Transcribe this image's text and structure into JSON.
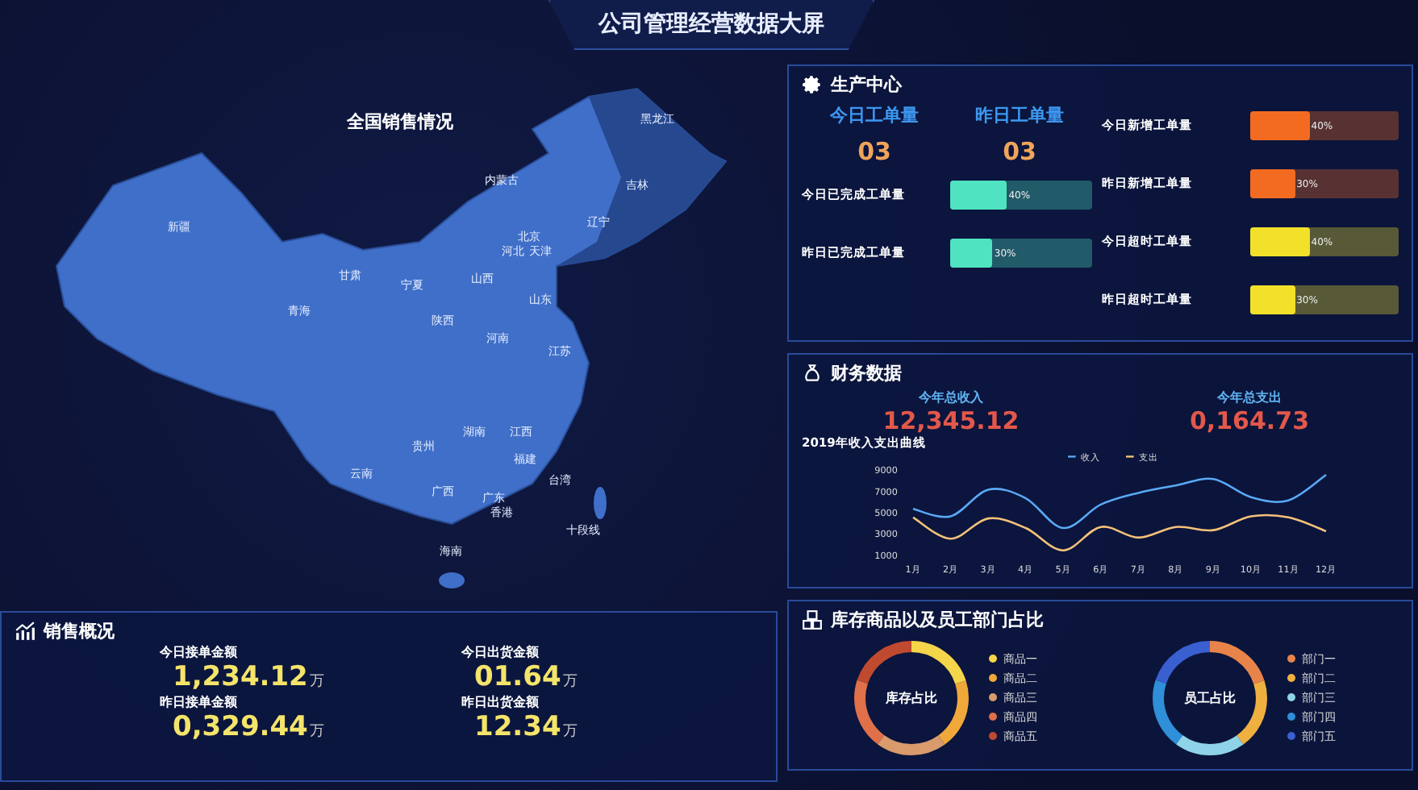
{
  "title": "公司管理经营数据大屏",
  "map": {
    "title": "全国销售情况",
    "provinces": [
      "新疆",
      "青海",
      "甘肃",
      "宁夏",
      "内蒙古",
      "黑龙江",
      "吉林",
      "辽宁",
      "北京",
      "河北",
      "天津",
      "山西",
      "山东",
      "陕西",
      "河南",
      "江苏",
      "湖南",
      "江西",
      "贵州",
      "福建",
      "云南",
      "广西",
      "广东",
      "香港",
      "台湾",
      "十段线",
      "海南"
    ]
  },
  "sales": {
    "title": "销售概况",
    "items": [
      {
        "label": "今日接单金额",
        "value": "1,234.12",
        "unit": "万"
      },
      {
        "label": "今日出货金额",
        "value": "01.64",
        "unit": "万"
      },
      {
        "label": "昨日接单金额",
        "value": "0,329.44",
        "unit": "万"
      },
      {
        "label": "昨日出货金额",
        "value": "12.34",
        "unit": "万"
      }
    ]
  },
  "production": {
    "title": "生产中心",
    "kpis": [
      {
        "label": "今日工单量",
        "value": "03"
      },
      {
        "label": "昨日工单量",
        "value": "03"
      }
    ],
    "bars": [
      {
        "label": "今日新增工单量",
        "level": 0.4,
        "reading": "40%",
        "color": "#f26b21"
      },
      {
        "label": "昨日新增工单量",
        "level": 0.3,
        "reading": "30%",
        "color": "#f26b21"
      },
      {
        "label": "今日已完成工单量",
        "level": 0.4,
        "reading": "40%",
        "color": "#4fe3c1"
      },
      {
        "label": "今日超时工单量",
        "level": 0.4,
        "reading": "40%",
        "color": "#f2e02a"
      },
      {
        "label": "昨日已完成工单量",
        "level": 0.3,
        "reading": "30%",
        "color": "#4fe3c1"
      },
      {
        "label": "昨日超时工单量",
        "level": 0.3,
        "reading": "30%",
        "color": "#f2e02a"
      }
    ]
  },
  "finance": {
    "title": "财务数据",
    "kpis": [
      {
        "label": "今年总收入",
        "value": "12,345.12"
      },
      {
        "label": "今年总支出",
        "value": "0,164.73"
      }
    ],
    "chart_data": {
      "type": "line",
      "title": "2019年收入支出曲线",
      "legend": "top",
      "categories": [
        "1月",
        "2月",
        "3月",
        "4月",
        "5月",
        "6月",
        "7月",
        "8月",
        "9月",
        "10月",
        "11月",
        "12月"
      ],
      "ylim": [
        1000,
        9000
      ],
      "yticks": [
        1000,
        3000,
        5000,
        7000,
        9000
      ],
      "series": [
        {
          "name": "收入",
          "color": "#5aa9f5",
          "values": [
            5300,
            4600,
            7100,
            6300,
            3500,
            5700,
            6800,
            7500,
            8100,
            6400,
            6100,
            8500
          ]
        },
        {
          "name": "支出",
          "color": "#f5c27a",
          "values": [
            4500,
            2500,
            4400,
            3500,
            1400,
            3600,
            2600,
            3600,
            3300,
            4600,
            4500,
            3200
          ]
        }
      ]
    }
  },
  "inventory": {
    "title": "库存商品以及员工部门占比",
    "donuts": [
      {
        "center": "库存占比",
        "legend": [
          {
            "name": "商品一",
            "color": "#f5d54a"
          },
          {
            "name": "商品二",
            "color": "#f0a83a"
          },
          {
            "name": "商品三",
            "color": "#d99a6c"
          },
          {
            "name": "商品四",
            "color": "#e0704a"
          },
          {
            "name": "商品五",
            "color": "#c04a30"
          }
        ]
      },
      {
        "center": "员工占比",
        "legend": [
          {
            "name": "部门一",
            "color": "#e8844a"
          },
          {
            "name": "部门二",
            "color": "#f0b040"
          },
          {
            "name": "部门三",
            "color": "#8fd3e8"
          },
          {
            "name": "部门四",
            "color": "#2f8fd8"
          },
          {
            "name": "部门五",
            "color": "#3a5fd0"
          }
        ]
      }
    ]
  }
}
